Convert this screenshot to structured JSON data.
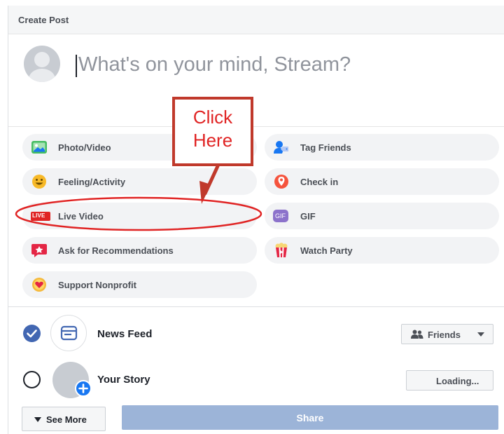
{
  "header": {
    "title": "Create Post"
  },
  "composer": {
    "placeholder": "What's on your mind, Stream?"
  },
  "annotation": {
    "callout_text": "Click Here"
  },
  "options": {
    "photo_video": "Photo/Video",
    "tag_friends": "Tag Friends",
    "feeling_activity": "Feeling/Activity",
    "check_in": "Check in",
    "live_video": "Live Video",
    "live_badge": "LIVE",
    "gif": "GIF",
    "gif_badge": "GIF",
    "ask_recommendations": "Ask for Recommendations",
    "watch_party": "Watch Party",
    "support_nonprofit": "Support Nonprofit"
  },
  "destinations": {
    "news_feed": {
      "label": "News Feed",
      "checked": true,
      "audience": "Friends"
    },
    "your_story": {
      "label": "Your Story",
      "checked": false,
      "status": "Loading..."
    }
  },
  "footer": {
    "see_more": "See More",
    "share": "Share"
  },
  "colors": {
    "accent": "#4267b2",
    "annotation_red": "#c0392b",
    "share_disabled": "#9cb4d8"
  }
}
